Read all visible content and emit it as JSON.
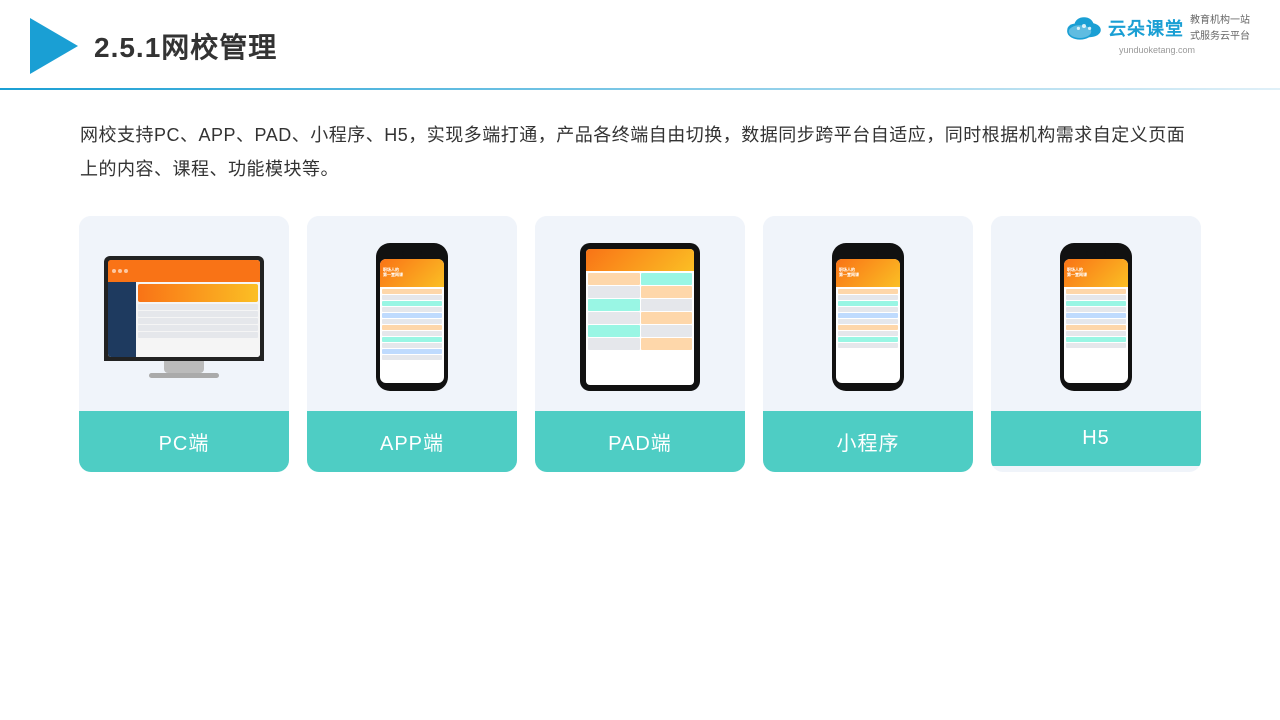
{
  "header": {
    "title": "2.5.1网校管理",
    "brand": {
      "name": "云朵课堂",
      "url": "yunduoketang.com",
      "slogan_line1": "教育机构一站",
      "slogan_line2": "式服务云平台"
    }
  },
  "description": "网校支持PC、APP、PAD、小程序、H5，实现多端打通，产品各终端自由切换，数据同步跨平台自适应，同时根据机构需求自定义页面上的内容、课程、功能模块等。",
  "cards": [
    {
      "id": "pc",
      "label": "PC端",
      "type": "pc"
    },
    {
      "id": "app",
      "label": "APP端",
      "type": "phone"
    },
    {
      "id": "pad",
      "label": "PAD端",
      "type": "tablet"
    },
    {
      "id": "mini",
      "label": "小程序",
      "type": "phone"
    },
    {
      "id": "h5",
      "label": "H5",
      "type": "phone"
    }
  ]
}
